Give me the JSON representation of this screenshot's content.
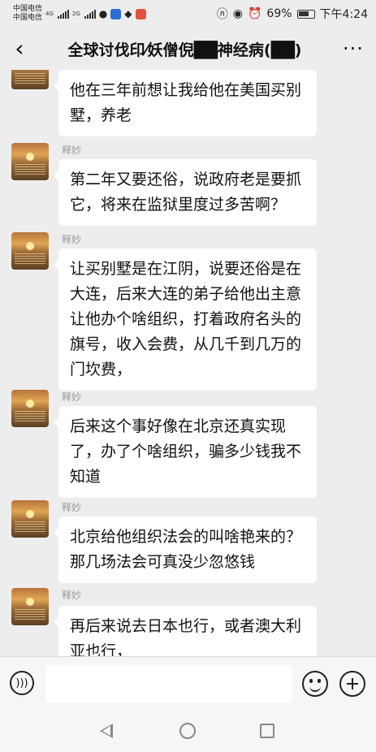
{
  "status_bar": {
    "carrier1": "中国电信",
    "carrier2": "中国电信",
    "net1": "4G",
    "net2": "2G",
    "battery": "69%",
    "time": "下午4:24"
  },
  "header": {
    "back_icon": "chevron-left-icon",
    "title": "全球讨伐印⁄妖僧倪██神经病(██)",
    "more_icon": "more-dots-icon"
  },
  "messages": [
    {
      "name": "",
      "text": "他在三年前想让我给他在美国买别墅，养老"
    },
    {
      "name": "释妙",
      "text": "第二年又要还俗，说政府老是要抓它，将来在监狱里度过多苦啊？"
    },
    {
      "name": "释妙",
      "text": "让买别墅是在江阴，说要还俗是在大连，后来大连的弟子给他出主意让他办个啥组织，打着政府名头的旗号，收入会费，从几千到几万的门坎费，"
    },
    {
      "name": "释妙",
      "text": "后来这个事好像在北京还真实现了，办了个啥组织，骗多少钱我不知道"
    },
    {
      "name": "释妙",
      "text": "北京给他组织法会的叫啥艳来的？那几场法会可真没少忽悠钱"
    },
    {
      "name": "释妙",
      "text": "再后来说去日本也行，或者澳大利亚也行，"
    }
  ],
  "input_bar": {
    "voice_icon": "voice-icon",
    "emoji_icon": "emoji-icon",
    "plus_icon": "plus-icon"
  },
  "system_nav": {
    "back_icon": "triangle-back-icon",
    "home_icon": "circle-home-icon",
    "recent_icon": "square-recent-icon"
  }
}
